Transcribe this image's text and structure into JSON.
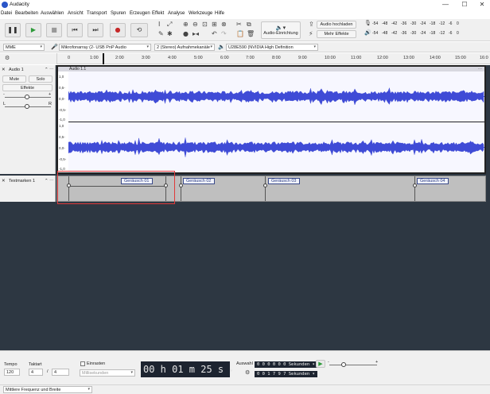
{
  "window": {
    "title": "Audacity",
    "minimize": "—",
    "maximize": "☐",
    "close": "✕"
  },
  "menu": [
    "Datei",
    "Bearbeiten",
    "Auswählen",
    "Ansicht",
    "Transport",
    "Spuren",
    "Erzeugen",
    "Effekt",
    "Analyse",
    "Werkzeuge",
    "Hilfe"
  ],
  "toolbar": {
    "audio_setup_label": "Audio-Einrichtung",
    "share_label": "Audio hochladen",
    "effects_label": "Mehr Effekte",
    "meter_ticks_rec": [
      "-54",
      "-48",
      "-42",
      "-36",
      "-30",
      "-24",
      "-18",
      "-12",
      "-6",
      "0"
    ],
    "meter_ticks_play": [
      "-54",
      "-48",
      "-42",
      "-36",
      "-30",
      "-24",
      "-18",
      "-12",
      "-6",
      "0"
    ]
  },
  "devices": {
    "host": "MME",
    "recording_device": "Mikrofonarray (2- USB PnP Audio",
    "channels": "2 (Stereo) Aufnahmekanäle",
    "playback_device": "U28E590 (NVIDIA High Definition"
  },
  "ruler": {
    "ticks": [
      "0",
      "1:00",
      "2:00",
      "3:00",
      "4:00",
      "5:00",
      "6:00",
      "7:00",
      "8:00",
      "9:00",
      "10:00",
      "11:00",
      "12:00",
      "13:00",
      "14:00",
      "15:00",
      "16:0"
    ]
  },
  "audio_track": {
    "name": "Audio 1",
    "clip_name": "Audio 1.1",
    "mute_label": "Mute",
    "solo_label": "Solo",
    "effects_label": "Effekte",
    "gain_min": "-",
    "gain_max": "+",
    "pan_left": "L",
    "pan_right": "R",
    "scale_top": [
      "1,0",
      "0,5-",
      "0,0-",
      "-0,5-",
      "-1,0"
    ],
    "scale_bottom": [
      "1,0",
      "0,5-",
      "0,0-",
      "-0,5-",
      "-1,0"
    ]
  },
  "label_track": {
    "name": "Textmarken 1",
    "labels": [
      "Geräusch 01",
      "Geräusch 02",
      "Geräusch 03",
      "Geräusch 04"
    ]
  },
  "bottom": {
    "tempo_label": "Tempo",
    "tempo_value": "120",
    "time_sig_label": "Taktart",
    "time_sig_num": "4",
    "time_sig_slash": "/",
    "time_sig_den": "4",
    "snap_label": "Einrasten",
    "snap_unit": "Millisekunden",
    "time_display": "00 h 01 m 25 s",
    "selection_label": "Auswahl",
    "sel_start": "0 0 0 0 0 0 Sekunden",
    "sel_end": "0 0 1 7 9 7 Sekunden",
    "status_text": "Mittlere Frequenz und Breite"
  },
  "colors": {
    "waveform": "#3f4bd6",
    "selection": "#e03a3a",
    "background": "#2d3742"
  }
}
